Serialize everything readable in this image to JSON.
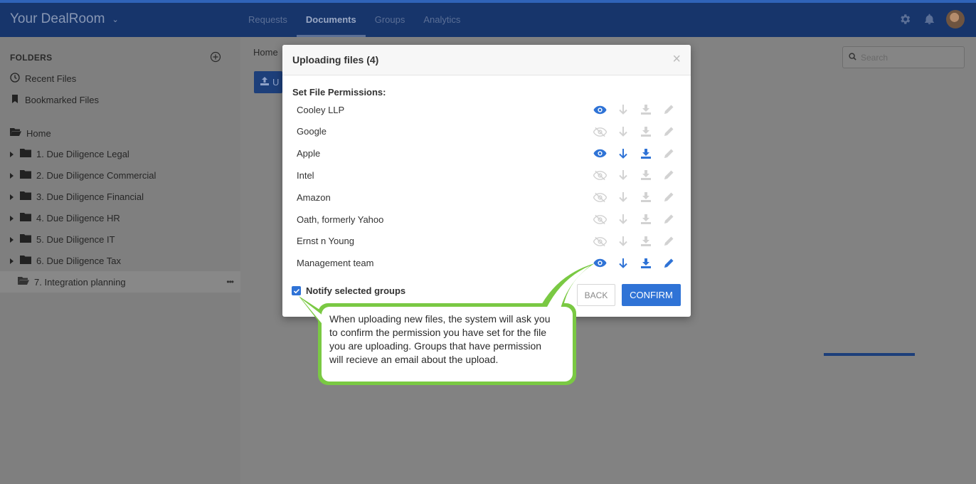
{
  "topbar": {
    "brand": "Your DealRoom",
    "tabs": [
      {
        "label": "Requests",
        "active": false
      },
      {
        "label": "Documents",
        "active": true
      },
      {
        "label": "Groups",
        "active": false
      },
      {
        "label": "Analytics",
        "active": false
      }
    ]
  },
  "sidebar": {
    "heading": "FOLDERS",
    "quick": [
      {
        "label": "Recent Files",
        "icon": "clock-icon"
      },
      {
        "label": "Bookmarked Files",
        "icon": "bookmark-icon"
      }
    ],
    "home": "Home",
    "folders": [
      "1. Due Diligence Legal",
      "2. Due Diligence Commercial",
      "3. Due Diligence Financial",
      "4. Due Diligence HR",
      "5. Due Diligence IT",
      "6. Due Diligence Tax"
    ],
    "selected_folder": "7. Integration planning",
    "more": "•••"
  },
  "main": {
    "breadcrumb": "Home",
    "upload_label": "U",
    "search_placeholder": "Search"
  },
  "modal": {
    "title": "Uploading files (4)",
    "close": "×",
    "permissions_heading": "Set File Permissions:",
    "groups": [
      {
        "name": "Cooley LLP",
        "view": true,
        "download": false,
        "download_file": false,
        "edit": false
      },
      {
        "name": "Google",
        "view": false,
        "download": false,
        "download_file": false,
        "edit": false
      },
      {
        "name": "Apple",
        "view": true,
        "download": true,
        "download_file": true,
        "edit": false
      },
      {
        "name": "Intel",
        "view": false,
        "download": false,
        "download_file": false,
        "edit": false
      },
      {
        "name": "Amazon",
        "view": false,
        "download": false,
        "download_file": false,
        "edit": false
      },
      {
        "name": "Oath, formerly Yahoo",
        "view": false,
        "download": false,
        "download_file": false,
        "edit": false
      },
      {
        "name": "Ernst n Young",
        "view": false,
        "download": false,
        "download_file": false,
        "edit": false
      },
      {
        "name": "Management team",
        "view": true,
        "download": true,
        "download_file": true,
        "edit": true
      }
    ],
    "notify_label": "Notify selected groups",
    "notify_checked": true,
    "back_label": "BACK",
    "confirm_label": "CONFIRM"
  },
  "callout": {
    "text": "When uploading new files, the system will ask you to confirm the permission you have set for the file you are uploading. Groups that have permission will recieve an email about the upload."
  },
  "colors": {
    "active_blue": "#2f73d6",
    "inactive_grey": "#d2d2d2",
    "callout_green": "#7ac943",
    "navbar": "#17356b"
  }
}
